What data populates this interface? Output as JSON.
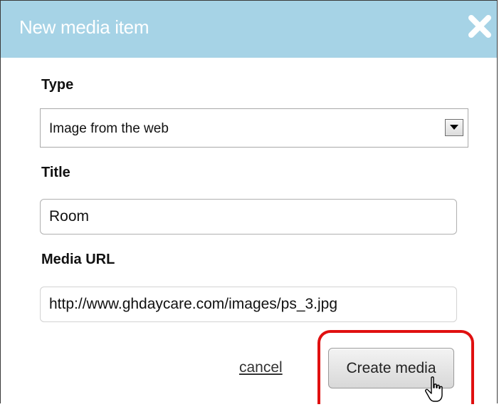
{
  "dialog": {
    "title": "New media item",
    "close_icon": "close-icon"
  },
  "form": {
    "type_label": "Type",
    "type_value": "Image from the web",
    "title_label": "Title",
    "title_value": "Room",
    "url_label": "Media URL",
    "url_value": "http://www.ghdaycare.com/images/ps_3.jpg"
  },
  "actions": {
    "cancel_label": "cancel",
    "create_label": "Create media"
  },
  "colors": {
    "titlebar": "#a6d3e6",
    "highlight": "#e01010"
  }
}
